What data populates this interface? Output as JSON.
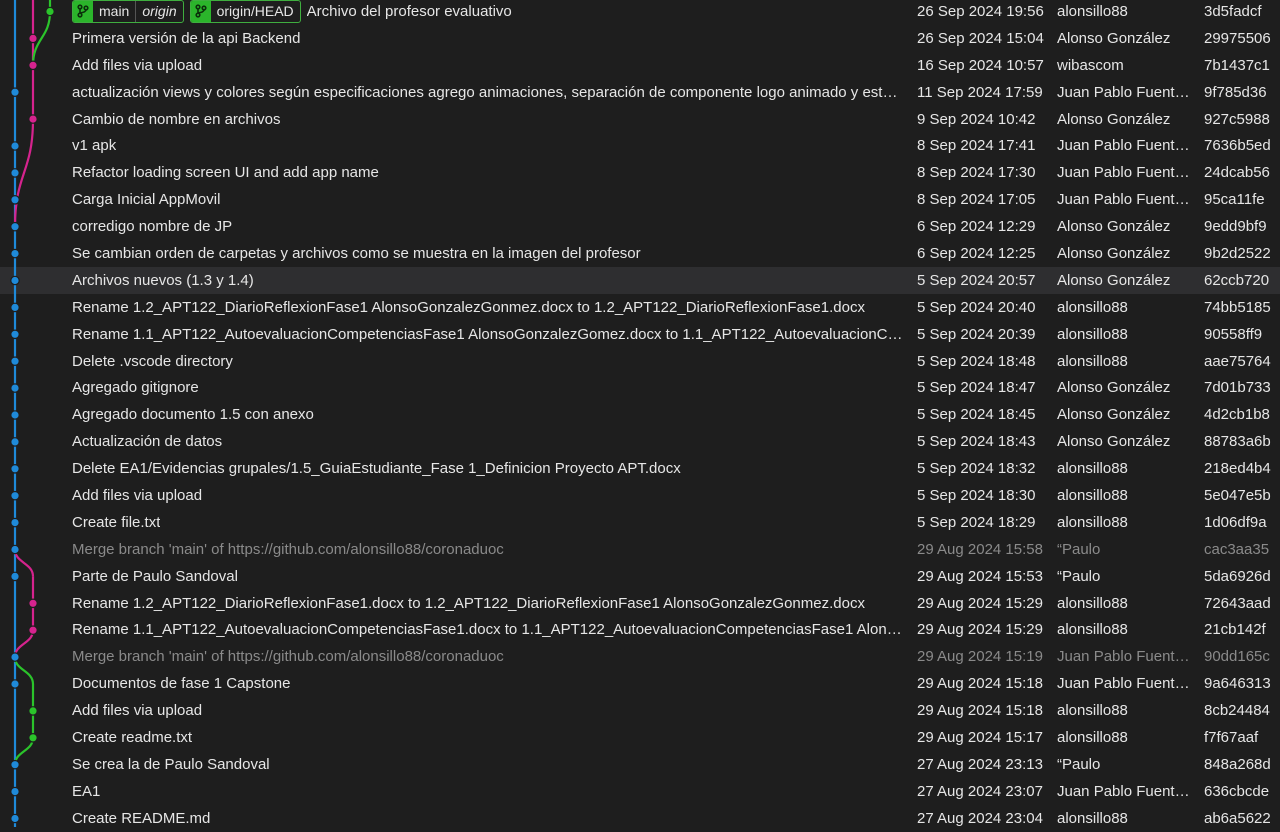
{
  "colors": {
    "blue": "#1f8ad9",
    "magenta": "#d6238e",
    "green": "#2bc42b",
    "background": "#1e1e1e",
    "selected_row": "#2e2e30"
  },
  "head_refs": {
    "local_branch": "main",
    "local_remote": "origin",
    "remote_branch": "origin/HEAD",
    "icon": "branch-icon"
  },
  "commits": [
    {
      "message": "Archivo del profesor evaluativo",
      "date": "26 Sep 2024 19:56",
      "author": "alonsillo88",
      "hash": "3d5fadcf"
    },
    {
      "message": "Primera versión de la api Backend",
      "date": "26 Sep 2024 15:04",
      "author": "Alonso González",
      "hash": "29975506"
    },
    {
      "message": "Add files via upload",
      "date": "16 Sep 2024 10:57",
      "author": "wibascom",
      "hash": "7b1437c1"
    },
    {
      "message": "actualización views y colores según especificaciones agrego animaciones, separación de componente logo animado y est…",
      "date": "11 Sep 2024 17:59",
      "author": "Juan Pablo Fuente…",
      "hash": "9f785d36"
    },
    {
      "message": "Cambio de nombre en archivos",
      "date": "9 Sep 2024 10:42",
      "author": "Alonso González",
      "hash": "927c5988"
    },
    {
      "message": "v1 apk",
      "date": "8 Sep 2024 17:41",
      "author": "Juan Pablo Fuente…",
      "hash": "7636b5ed"
    },
    {
      "message": "Refactor loading screen UI and add app name",
      "date": "8 Sep 2024 17:30",
      "author": "Juan Pablo Fuente…",
      "hash": "24dcab56"
    },
    {
      "message": "Carga Inicial AppMovil",
      "date": "8 Sep 2024 17:05",
      "author": "Juan Pablo Fuente…",
      "hash": "95ca11fe"
    },
    {
      "message": "corredigo nombre de JP",
      "date": "6 Sep 2024 12:29",
      "author": "Alonso González",
      "hash": "9edd9bf9"
    },
    {
      "message": "Se cambian orden de carpetas y archivos como se muestra en la imagen del profesor",
      "date": "6 Sep 2024 12:25",
      "author": "Alonso González",
      "hash": "9b2d2522"
    },
    {
      "message": "Archivos nuevos (1.3 y 1.4)",
      "date": "5 Sep 2024 20:57",
      "author": "Alonso González",
      "hash": "62ccb720"
    },
    {
      "message": "Rename 1.2_APT122_DiarioReflexionFase1 AlonsoGonzalezGonmez.docx to 1.2_APT122_DiarioReflexionFase1.docx",
      "date": "5 Sep 2024 20:40",
      "author": "alonsillo88",
      "hash": "74bb5185"
    },
    {
      "message": "Rename 1.1_APT122_AutoevaluacionCompetenciasFase1 AlonsoGonzalezGomez.docx to 1.1_APT122_AutoevaluacionCom…",
      "date": "5 Sep 2024 20:39",
      "author": "alonsillo88",
      "hash": "90558ff9"
    },
    {
      "message": "Delete .vscode directory",
      "date": "5 Sep 2024 18:48",
      "author": "alonsillo88",
      "hash": "aae75764"
    },
    {
      "message": "Agregado gitignore",
      "date": "5 Sep 2024 18:47",
      "author": "Alonso González",
      "hash": "7d01b733"
    },
    {
      "message": "Agregado documento 1.5 con anexo",
      "date": "5 Sep 2024 18:45",
      "author": "Alonso González",
      "hash": "4d2cb1b8"
    },
    {
      "message": "Actualización de datos",
      "date": "5 Sep 2024 18:43",
      "author": "Alonso González",
      "hash": "88783a6b"
    },
    {
      "message": "Delete EA1/Evidencias grupales/1.5_GuiaEstudiante_Fase 1_Definicion Proyecto APT.docx",
      "date": "5 Sep 2024 18:32",
      "author": "alonsillo88",
      "hash": "218ed4b4"
    },
    {
      "message": "Add files via upload",
      "date": "5 Sep 2024 18:30",
      "author": "alonsillo88",
      "hash": "5e047e5b"
    },
    {
      "message": "Create file.txt",
      "date": "5 Sep 2024 18:29",
      "author": "alonsillo88",
      "hash": "1d06df9a"
    },
    {
      "message": "Merge branch 'main' of https://github.com/alonsillo88/coronaduoc",
      "date": "29 Aug 2024 15:58",
      "author": "“Paulo",
      "hash": "cac3aa35"
    },
    {
      "message": "Parte de Paulo Sandoval",
      "date": "29 Aug 2024 15:53",
      "author": "“Paulo",
      "hash": "5da6926d"
    },
    {
      "message": "Rename 1.2_APT122_DiarioReflexionFase1.docx to 1.2_APT122_DiarioReflexionFase1 AlonsoGonzalezGonmez.docx",
      "date": "29 Aug 2024 15:29",
      "author": "alonsillo88",
      "hash": "72643aad"
    },
    {
      "message": "Rename 1.1_APT122_AutoevaluacionCompetenciasFase1.docx to 1.1_APT122_AutoevaluacionCompetenciasFase1 Alonso…",
      "date": "29 Aug 2024 15:29",
      "author": "alonsillo88",
      "hash": "21cb142f"
    },
    {
      "message": "Merge branch 'main' of https://github.com/alonsillo88/coronaduoc",
      "date": "29 Aug 2024 15:19",
      "author": "Juan Pablo Fuente…",
      "hash": "90dd165c"
    },
    {
      "message": "Documentos de fase 1 Capstone",
      "date": "29 Aug 2024 15:18",
      "author": "Juan Pablo Fuente…",
      "hash": "9a646313"
    },
    {
      "message": "Add files via upload",
      "date": "29 Aug 2024 15:18",
      "author": "alonsillo88",
      "hash": "8cb24484"
    },
    {
      "message": "Create readme.txt",
      "date": "29 Aug 2024 15:17",
      "author": "alonsillo88",
      "hash": "f7f67aaf"
    },
    {
      "message": "Se crea la de Paulo Sandoval",
      "date": "27 Aug 2024 23:13",
      "author": "“Paulo",
      "hash": "848a268d"
    },
    {
      "message": "EA1",
      "date": "27 Aug 2024 23:07",
      "author": "Juan Pablo Fuente…",
      "hash": "636cbcde"
    },
    {
      "message": "Create README.md",
      "date": "27 Aug 2024 23:04",
      "author": "alonsillo88",
      "hash": "ab6a5622"
    }
  ]
}
